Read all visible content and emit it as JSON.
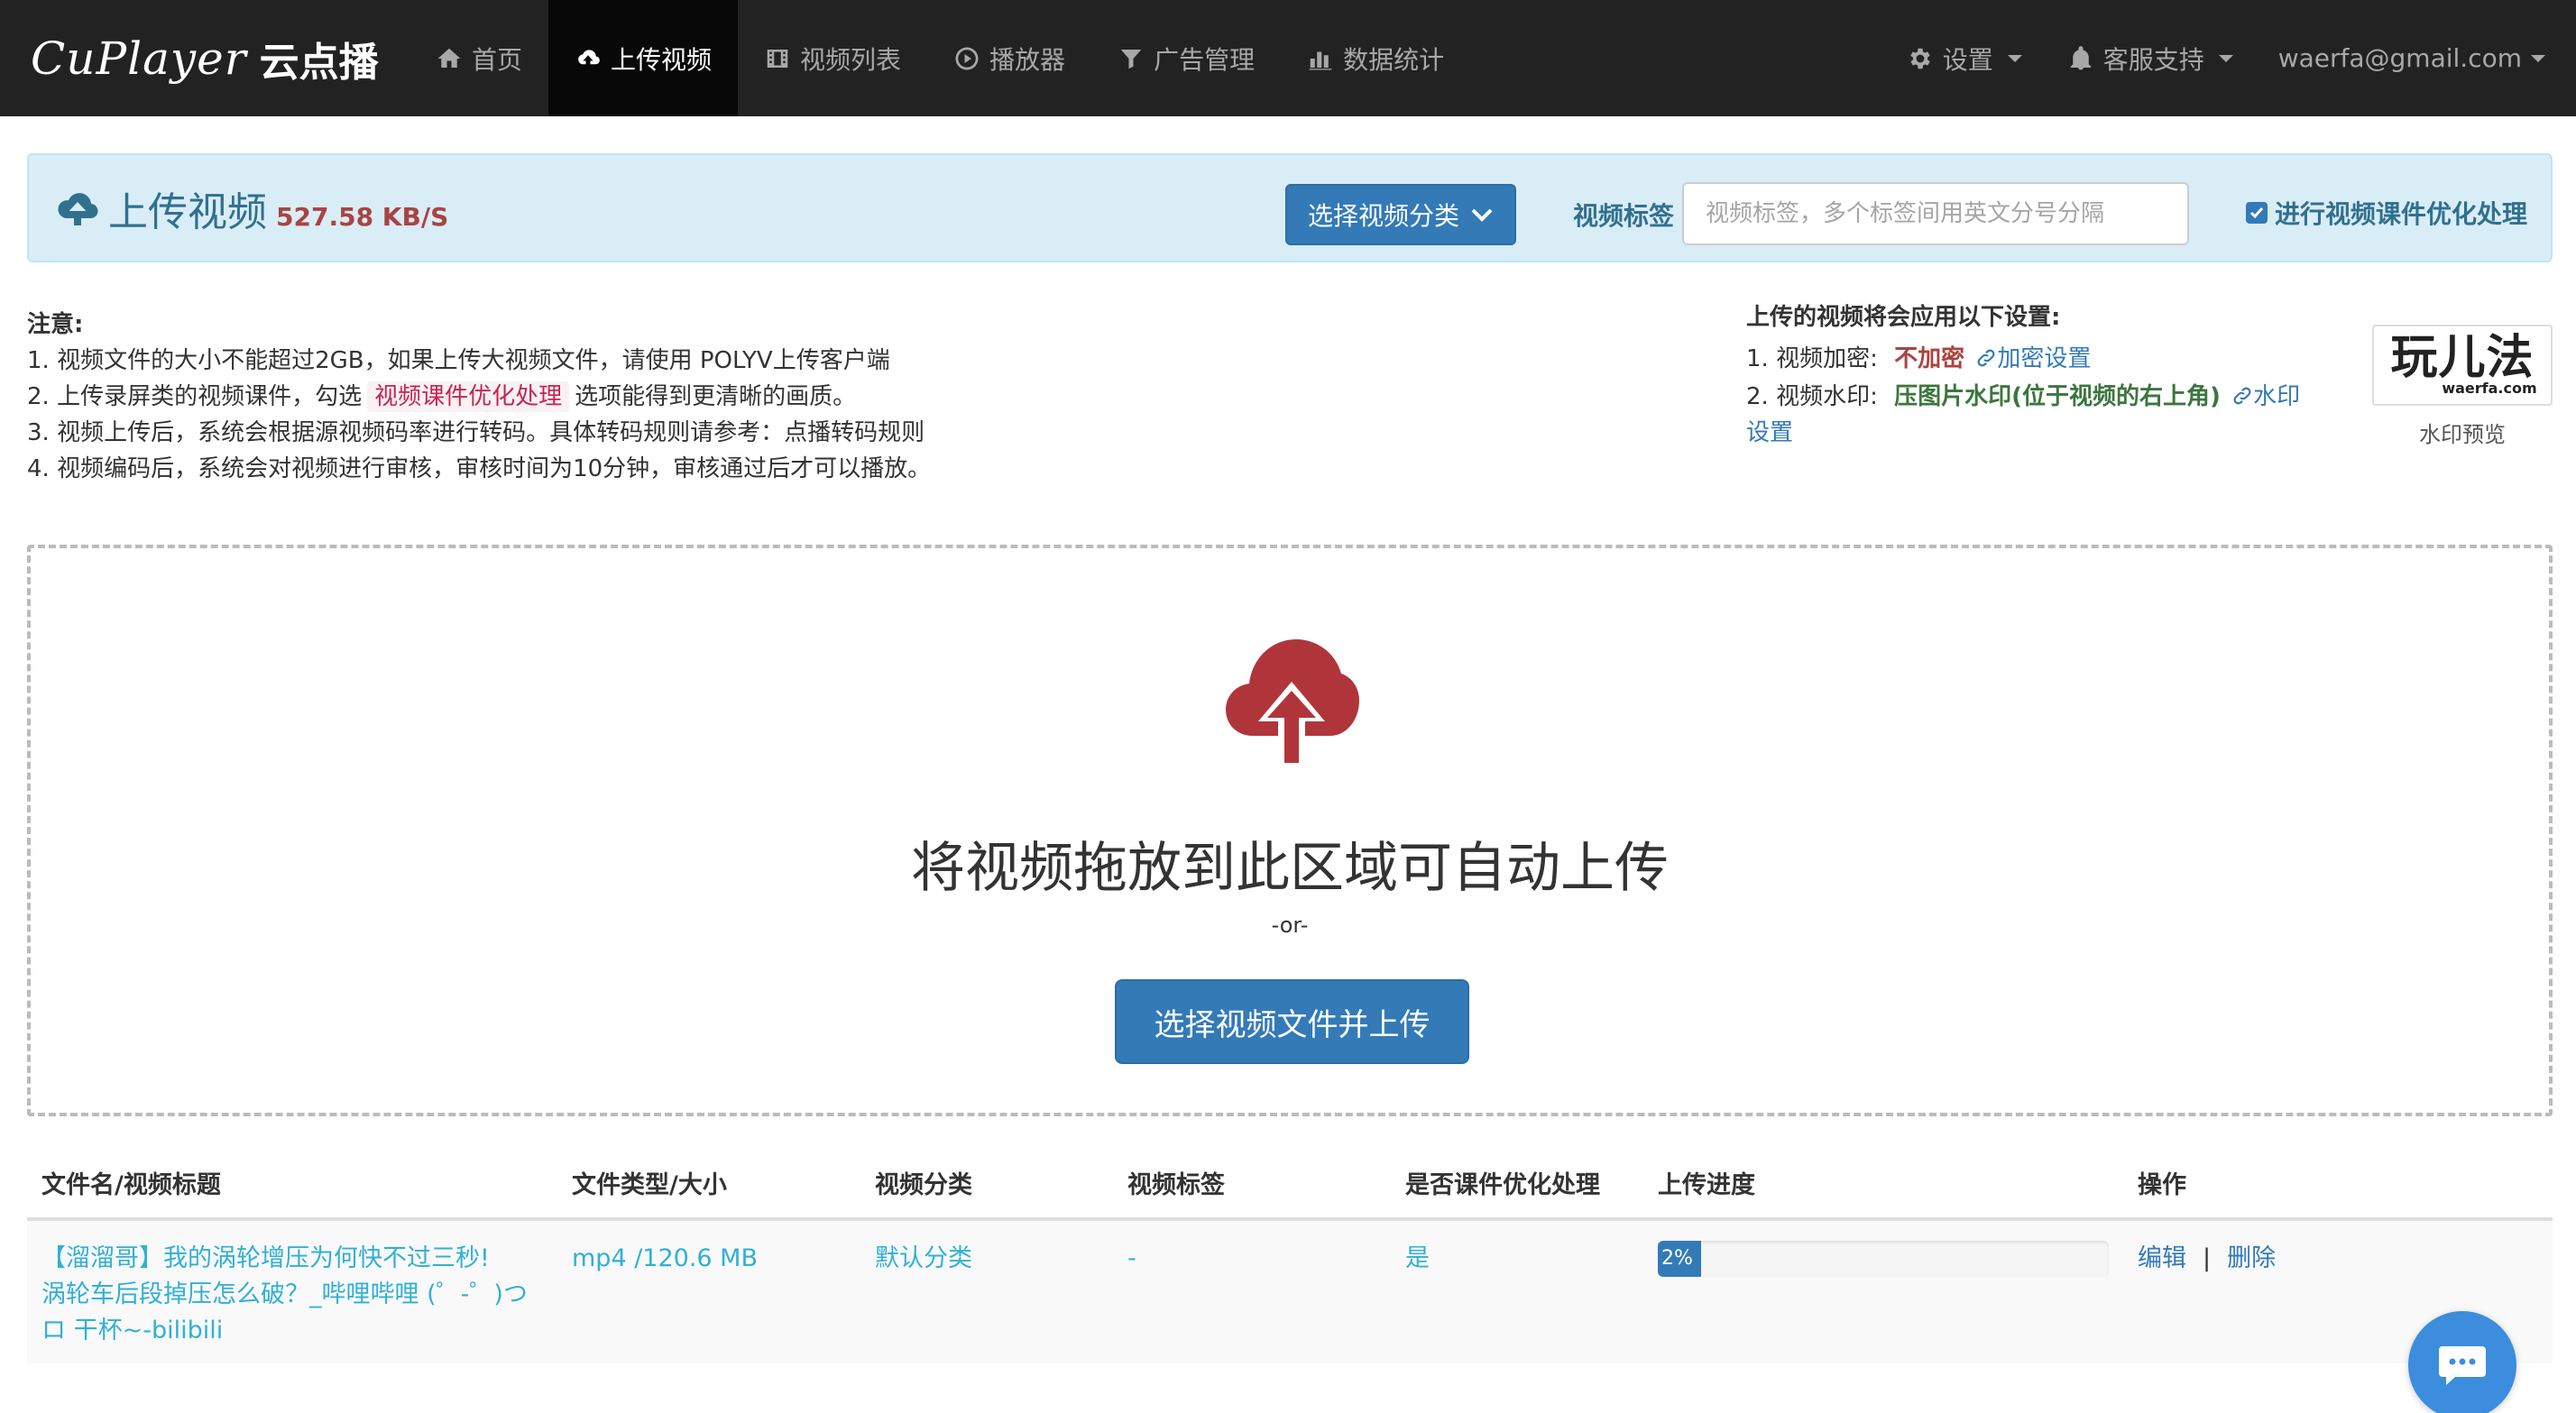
{
  "brand": {
    "latin": "CuPlayer",
    "cjk": "云点播"
  },
  "nav": {
    "items": [
      {
        "label": "首页",
        "icon": "home-icon"
      },
      {
        "label": "上传视频",
        "icon": "cloud-upload-icon",
        "active": true
      },
      {
        "label": "视频列表",
        "icon": "film-icon"
      },
      {
        "label": "播放器",
        "icon": "play-circle-icon"
      },
      {
        "label": "广告管理",
        "icon": "filter-icon"
      },
      {
        "label": "数据统计",
        "icon": "bar-chart-icon"
      }
    ],
    "right": {
      "settings": "设置",
      "support": "客服支持",
      "user": "waerfa@gmail.com"
    }
  },
  "upload_panel": {
    "title": "上传视频",
    "speed": "527.58 KB/S",
    "category_button": "选择视频分类",
    "tag_label": "视频标签",
    "tag_placeholder": "视频标签，多个标签间用英文分号分隔",
    "optimize_label": "进行视频课件优化处理",
    "optimize_checked": true
  },
  "notes": {
    "title": "注意:",
    "line1": "1. 视频文件的大小不能超过2GB，如果上传大视频文件，请使用 POLYV上传客户端",
    "line2_pre": "2. 上传录屏类的视频课件，勾选",
    "line2_highlight": "视频课件优化处理",
    "line2_post": "选项能得到更清晰的画质。",
    "line3": "3. 视频上传后，系统会根据源视频码率进行转码。具体转码规则请参考：点播转码规则",
    "line4": "4. 视频编码后，系统会对视频进行审核，审核时间为10分钟，审核通过后才可以播放。"
  },
  "settings": {
    "title": "上传的视频将会应用以下设置:",
    "encrypt_label": "1. 视频加密:",
    "encrypt_value": "不加密",
    "encrypt_link": "加密设置",
    "watermark_label": "2. 视频水印:",
    "watermark_value": "压图片水印(位于视频的右上角)",
    "watermark_link_a": "水印",
    "watermark_link_b": "设置",
    "preview_logo_main": "玩儿法",
    "preview_logo_sub": "waerfa.com",
    "preview_caption": "水印预览"
  },
  "dropzone": {
    "title": "将视频拖放到此区域可自动上传",
    "or": "-or-",
    "button": "选择视频文件并上传"
  },
  "table": {
    "headers": [
      "文件名/视频标题",
      "文件类型/大小",
      "视频分类",
      "视频标签",
      "是否课件优化处理",
      "上传进度",
      "操作"
    ],
    "rows": [
      {
        "name_line1": "【溜溜哥】我的涡轮增压为何快不过三秒!",
        "name_line2": "涡轮车后段掉压怎么破？_哔哩哔哩 (゜-゜)つ",
        "name_line3": "ロ 干杯~-bilibili",
        "type_size": "mp4 /120.6 MB",
        "category": "默认分类",
        "tags": "-",
        "optimized": "是",
        "progress": 0.02,
        "progress_label": "2%",
        "edit": "编辑",
        "sep": "|",
        "delete": "删除"
      }
    ]
  },
  "colors": {
    "navbar": "#222222",
    "primary": "#337ab7",
    "info_bg": "#d9edf7",
    "danger": "#a94442",
    "success": "#3c763d",
    "upload_icon": "#b0353b"
  }
}
